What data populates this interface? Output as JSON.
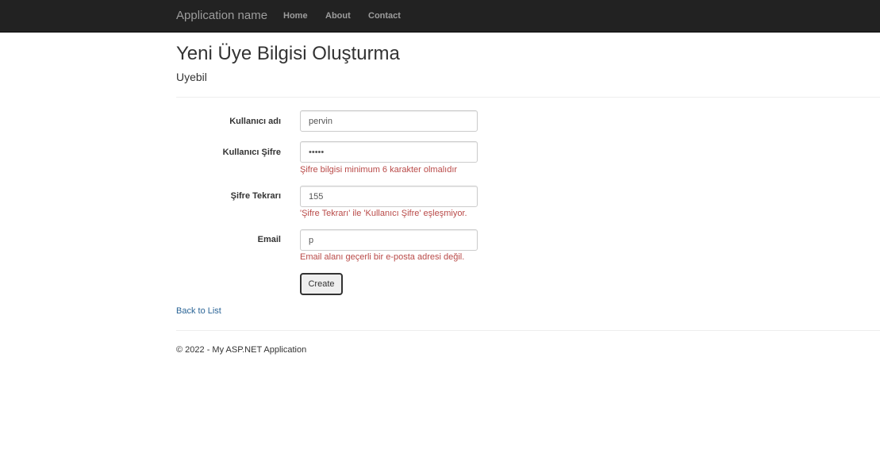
{
  "navbar": {
    "brand": "Application name",
    "links": [
      "Home",
      "About",
      "Contact"
    ]
  },
  "page": {
    "title": "Yeni Üye Bilgisi Oluşturma",
    "subtitle": "Uyebil"
  },
  "form": {
    "username": {
      "label": "Kullanıcı adı",
      "value": "pervin"
    },
    "password": {
      "label": "Kullanıcı Şifre",
      "value": "•••••",
      "error": "Şifre bilgisi minimum 6 karakter olmalıdır"
    },
    "password_repeat": {
      "label": "Şifre Tekrarı",
      "value": "155",
      "error": "'Şifre Tekrarı' ile 'Kullanıcı Şifre' eşleşmiyor."
    },
    "email": {
      "label": "Email",
      "value": "p",
      "error": "Email alanı geçerli bir e-posta adresi değil."
    },
    "create_label": "Create"
  },
  "back_link": "Back to List",
  "footer": "© 2022 - My ASP.NET Application",
  "colors": {
    "navbar_bg": "#222222",
    "nav_text": "#9d9d9d",
    "error_text": "#b94a48",
    "link": "#2a6496"
  }
}
